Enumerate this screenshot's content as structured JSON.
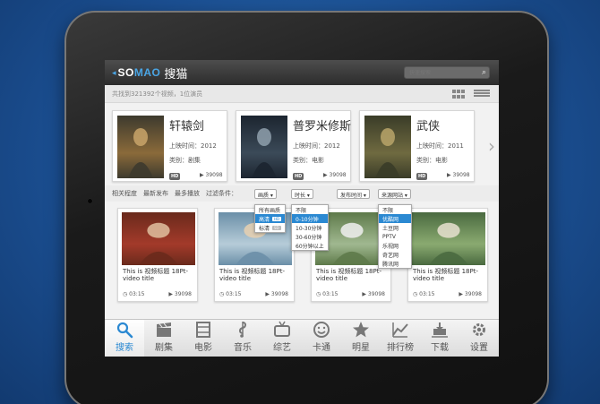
{
  "header": {
    "logo_arrow": "◂",
    "logo_so": "SO",
    "logo_mao": "MAO",
    "logo_cn": "搜猫",
    "search_placeholder": "快速搜索"
  },
  "summary": {
    "text": "共找到321392个视频，1位演员"
  },
  "featured": [
    {
      "title": "轩辕剑",
      "year": "上映时间：2012",
      "category": "类别：剧集",
      "hd": "HD",
      "plays": "▶ 39098",
      "colors": [
        "#3d3a2e",
        "#8a6a3a",
        "#c9a46a"
      ]
    },
    {
      "title": "普罗米修斯",
      "year": "上映时间：2012",
      "category": "类别：电影",
      "hd": "HD",
      "plays": "▶ 39098",
      "colors": [
        "#1c2530",
        "#3b4a58",
        "#8fa0ad"
      ]
    },
    {
      "title": "武侠",
      "year": "上映时间：2011",
      "category": "类别：电影",
      "hd": "HD",
      "plays": "▶ 39098",
      "colors": [
        "#3a3c28",
        "#6f6a40",
        "#b9a56a"
      ]
    }
  ],
  "filters": {
    "labels": [
      "相关程度",
      "最新发布",
      "最多播放",
      "过滤条件："
    ],
    "quality": {
      "label": "画质 ▾",
      "options": [
        {
          "text": "所有画质",
          "badge": "",
          "selected": false
        },
        {
          "text": "高清",
          "badge": "HD",
          "selected": true
        },
        {
          "text": "标清",
          "badge": "SD",
          "selected": false
        }
      ]
    },
    "duration": {
      "label": "时长 ▾",
      "options": [
        {
          "text": "不限",
          "selected": false
        },
        {
          "text": "0-10分钟",
          "selected": true
        },
        {
          "text": "10-30分钟",
          "selected": false
        },
        {
          "text": "30-60分钟",
          "selected": false
        },
        {
          "text": "60分钟以上",
          "selected": false
        }
      ]
    },
    "release": {
      "label": "发布时间 ▾"
    },
    "source": {
      "label": "来源网站 ▾",
      "options": [
        {
          "text": "不限",
          "selected": false
        },
        {
          "text": "优酷网",
          "selected": true
        },
        {
          "text": "土豆网",
          "selected": false
        },
        {
          "text": "PPTV",
          "selected": false
        },
        {
          "text": "乐视网",
          "selected": false
        },
        {
          "text": "奇艺网",
          "selected": false
        },
        {
          "text": "腾讯网",
          "selected": false
        }
      ]
    }
  },
  "videos": [
    {
      "title": "This is 视频标题 18Pt-video title",
      "duration": "03:15",
      "plays": "▶ 39098",
      "colors": [
        "#6a2a1c",
        "#a33a2a",
        "#e0c0a0"
      ]
    },
    {
      "title": "This is 视频标题 18Pt-video title",
      "duration": "03:15",
      "plays": "▶ 39098",
      "colors": [
        "#6b8fa8",
        "#b6ccd8",
        "#e8d0b0"
      ]
    },
    {
      "title": "This is 视频标题 18Pt-video title",
      "duration": "03:15",
      "plays": "▶ 39098",
      "colors": [
        "#5e7a4a",
        "#a0b890",
        "#f0f0f0"
      ]
    },
    {
      "title": "This is 视频标题 18Pt-video title",
      "duration": "03:15",
      "plays": "▶ 39098",
      "colors": [
        "#4a6a40",
        "#8aaa70",
        "#e8e0d0"
      ]
    }
  ],
  "tabs": [
    {
      "label": "搜索",
      "icon": "search-icon",
      "active": true
    },
    {
      "label": "剧集",
      "icon": "clapper-icon",
      "active": false
    },
    {
      "label": "电影",
      "icon": "film-icon",
      "active": false
    },
    {
      "label": "音乐",
      "icon": "music-icon",
      "active": false
    },
    {
      "label": "综艺",
      "icon": "tv-icon",
      "active": false
    },
    {
      "label": "卡通",
      "icon": "smiley-icon",
      "active": false
    },
    {
      "label": "明星",
      "icon": "star-icon",
      "active": false
    },
    {
      "label": "排行榜",
      "icon": "chart-icon",
      "active": false
    },
    {
      "label": "下载",
      "icon": "download-icon",
      "active": false
    },
    {
      "label": "设置",
      "icon": "gear-icon",
      "active": false
    }
  ],
  "colors": {
    "accent": "#2b89d2",
    "logo_blue": "#4aa6e6"
  }
}
